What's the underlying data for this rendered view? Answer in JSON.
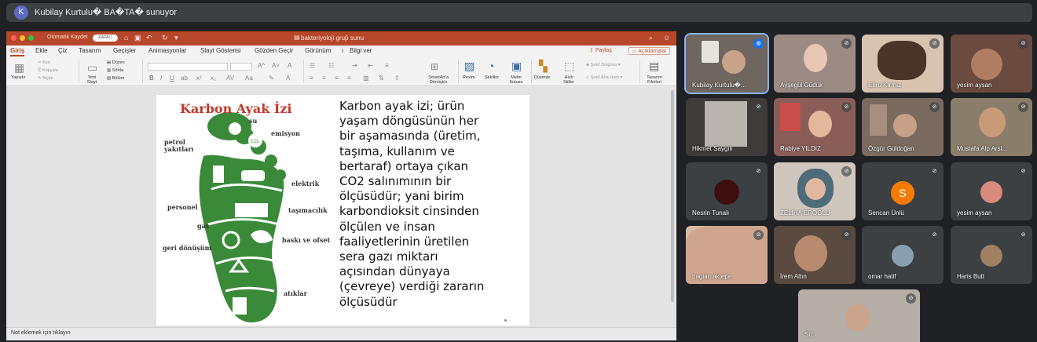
{
  "meeting": {
    "presenter_initial": "K",
    "presenting_text": "Kubilay Kurtulu� BA�TA� sunuyor"
  },
  "ppt": {
    "colors": {
      "accent": "#b7472a",
      "slide_title": "#c0392b",
      "foot_green": "#3a8a3a"
    },
    "autosave_label": "Otomatik Kaydet",
    "autosave_state": "KAPALI",
    "doc_title": "bakteriyoloji grup̂ sunu",
    "tell_me": "Bilgi ver",
    "share_label": "Paylaş",
    "comments_label": "Açıklamalar",
    "tabs": [
      "Giriş",
      "Ekle",
      "Çiz",
      "Tasarım",
      "Geçişler",
      "Animasyonlar",
      "Slayt Gösterisi",
      "Gözden Geçir",
      "Görünüm"
    ],
    "ribbon": {
      "paste": "Yapıştır",
      "cut": "Kes",
      "copy": "Kopyala",
      "format": "Biçim",
      "new_slide": "Yeni Slayt",
      "layout": "Düzen",
      "reset": "Sıfırla",
      "section": "Bölüm",
      "smartart": "SmartArt'a Dönüştür",
      "picture": "Resim",
      "shapes": "Şekiller",
      "textbox": "Metin Kutusu",
      "arrange": "Düzenle",
      "quick_styles": "Hızlı Stiller",
      "shape_fill": "Şekil Dolgusu",
      "shape_outline": "Şekil Ana Hattı",
      "designer": "Tasarım Fikirleri"
    },
    "notes_placeholder": "Not eklemek için tıklayın"
  },
  "slide": {
    "title": "Karbon Ayak İzi",
    "foot_labels": {
      "su": "su",
      "emisyon": "emisyon",
      "petrol": "petrol yakıtları",
      "elektrik": "elektrik",
      "personel": "personel",
      "tasimacilik": "taşımacılık",
      "gas": "gas",
      "baski": "baskı ve ofset",
      "geri": "geri dönüşüm",
      "atiklar": "atıklar",
      "co2_icon_text": "CO₂"
    },
    "body_lines": [
      "Karbon ayak izi; ürün",
      "yaşam döngüsünün her",
      "bir aşamasında (üretim,",
      "taşıma, kullanım ve",
      "bertaraf) ortaya çıkan",
      "CO2 salınımının bir",
      "ölçüsüdür; yani birim",
      "karbondioksit cinsinden",
      "ölçülen ve insan",
      "faaliyetlerinin üretilen",
      "sera gazı miktarı",
      "açısından dünyaya",
      "(çevreye) verdiği zararın",
      "ölçüsüdür"
    ]
  },
  "participants": [
    {
      "name": "Kubilay Kurtulu�...",
      "speaking": true
    },
    {
      "name": "Ayşegül Güdük"
    },
    {
      "name": "Ebru Kırmız"
    },
    {
      "name": "yesim aysan"
    },
    {
      "name": "Hikmet Saygılı"
    },
    {
      "name": "Rabiye YILDIZ"
    },
    {
      "name": "Özgür Güldoğan"
    },
    {
      "name": "Mustafa Alp Arsl..."
    },
    {
      "name": "Nesrin Tunalı"
    },
    {
      "name": "ZELİHA EROĞLU"
    },
    {
      "name": "Sencan Ünlü",
      "initial": "S"
    },
    {
      "name": "yesim aysan"
    },
    {
      "name": "bagian.aktepe"
    },
    {
      "name": "İrem Altın"
    },
    {
      "name": "omar hatif"
    },
    {
      "name": "Haris Butt"
    },
    {
      "name": "Siz"
    }
  ]
}
